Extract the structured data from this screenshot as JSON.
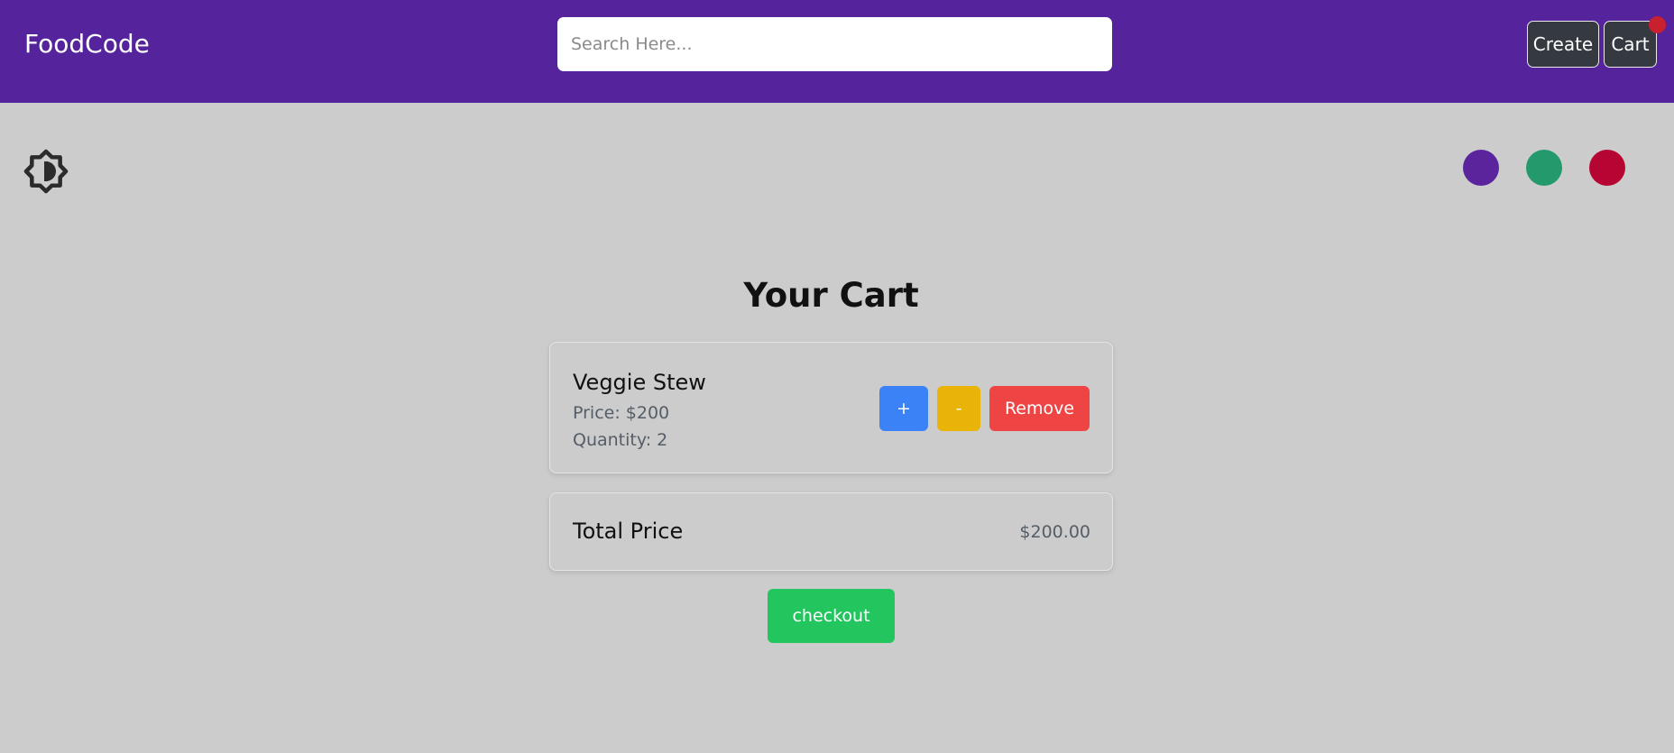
{
  "colors": {
    "navbar_bg": "#55239c",
    "page_bg": "#cccccc",
    "nav_button_bg": "#343a40",
    "cart_badge": "#c9202f",
    "plus_button": "#3b82f6",
    "minus_button": "#eab308",
    "remove_button": "#ef4444",
    "checkout_button": "#22c55e"
  },
  "navbar": {
    "brand": "FoodCode",
    "search_placeholder": "Search Here...",
    "create_label": "Create",
    "cart_label": "Cart"
  },
  "theme": {
    "toggle_icon": "brightness-contrast-icon",
    "swatches": [
      {
        "name": "purple",
        "color": "#5b249d"
      },
      {
        "name": "green",
        "color": "#249a6c"
      },
      {
        "name": "red",
        "color": "#b70533"
      }
    ]
  },
  "cart": {
    "title": "Your Cart",
    "items": [
      {
        "name": "Veggie Stew",
        "price_text": "Price: $200",
        "quantity_text": "Quantity: 2",
        "plus_label": "+",
        "minus_label": "-",
        "remove_label": "Remove"
      }
    ],
    "total_label": "Total Price",
    "total_value": "$200.00",
    "checkout_label": "checkout"
  }
}
